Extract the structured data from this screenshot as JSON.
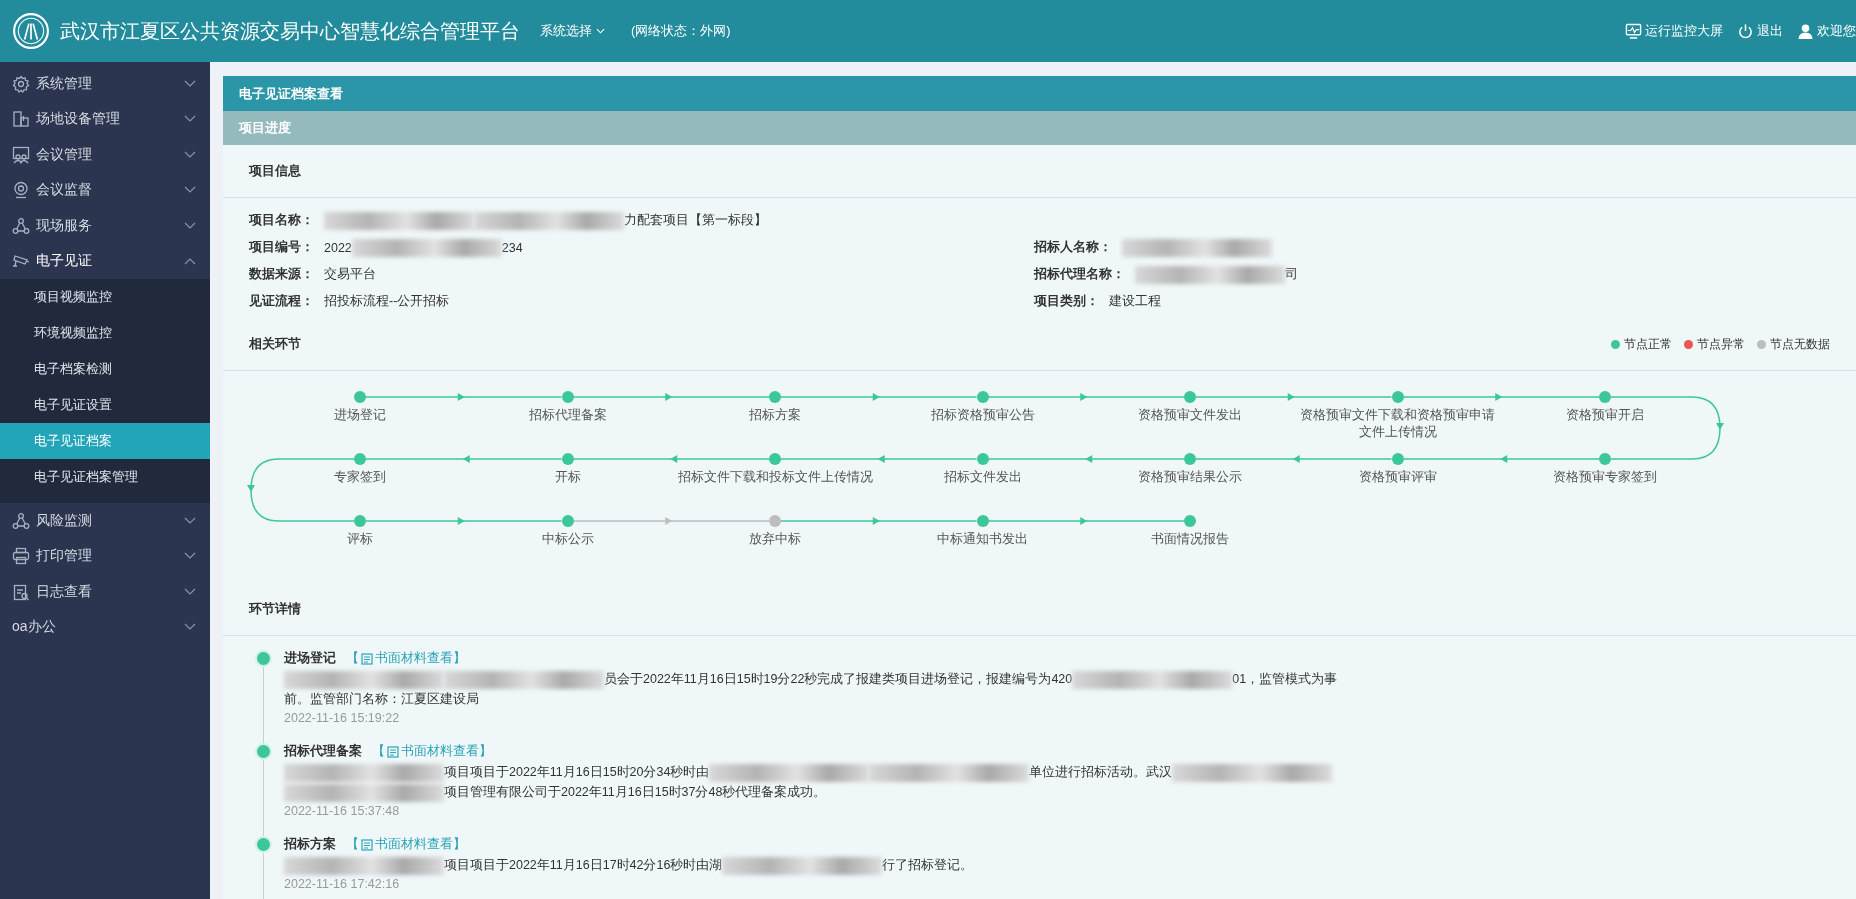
{
  "header": {
    "title": "武汉市江夏区公共资源交易中心智慧化综合管理平台",
    "system_select": "系统选择",
    "network_status": "(网络状态：外网)",
    "actions": [
      {
        "label": "运行监控大屏"
      },
      {
        "label": "退出"
      },
      {
        "label": "欢迎您"
      }
    ]
  },
  "sidebar": {
    "items": [
      {
        "label": "系统管理",
        "expanded": false
      },
      {
        "label": "场地设备管理",
        "expanded": false
      },
      {
        "label": "会议管理",
        "expanded": false
      },
      {
        "label": "会议监督",
        "expanded": false
      },
      {
        "label": "现场服务",
        "expanded": false
      },
      {
        "label": "电子见证",
        "expanded": true,
        "children": [
          {
            "label": "项目视频监控",
            "selected": false
          },
          {
            "label": "环境视频监控",
            "selected": false
          },
          {
            "label": "电子档案检测",
            "selected": false
          },
          {
            "label": "电子见证设置",
            "selected": false
          },
          {
            "label": "电子见证档案",
            "selected": true
          },
          {
            "label": "电子见证档案管理",
            "selected": false
          }
        ]
      },
      {
        "label": "风险监测",
        "expanded": false
      },
      {
        "label": "打印管理",
        "expanded": false
      },
      {
        "label": "日志查看",
        "expanded": false
      },
      {
        "label": "oa办公",
        "expanded": false
      }
    ]
  },
  "page_title": "电子见证档案查看",
  "sub_title": "项目进度",
  "project_info": {
    "title": "项目信息",
    "rows": [
      [
        {
          "label": "项目名称：",
          "parts": [
            {
              "kind": "redacted"
            },
            {
              "kind": "redacted"
            },
            {
              "kind": "text",
              "text": "力配套项目【第一标段】"
            }
          ]
        }
      ],
      [
        {
          "label": "项目编号：",
          "parts": [
            {
              "kind": "text",
              "text": "2022"
            },
            {
              "kind": "redacted"
            },
            {
              "kind": "text",
              "text": "234"
            }
          ]
        },
        {
          "label": "招标人名称：",
          "parts": [
            {
              "kind": "redacted"
            }
          ]
        }
      ],
      [
        {
          "label": "数据来源：",
          "parts": [
            {
              "kind": "text",
              "text": "交易平台"
            }
          ]
        },
        {
          "label": "招标代理名称：",
          "parts": [
            {
              "kind": "redacted"
            },
            {
              "kind": "text",
              "text": "司"
            }
          ]
        }
      ],
      [
        {
          "label": "见证流程：",
          "parts": [
            {
              "kind": "text",
              "text": "招投标流程--公开招标"
            }
          ]
        },
        {
          "label": "项目类别：",
          "parts": [
            {
              "kind": "text",
              "text": "建设工程"
            }
          ]
        }
      ]
    ]
  },
  "flow": {
    "title": "相关环节",
    "legend": [
      {
        "label": "节点正常",
        "color": "#3cc79a"
      },
      {
        "label": "节点异常",
        "color": "#e9574f"
      },
      {
        "label": "节点无数据",
        "color": "#bdbdbd"
      }
    ],
    "nodes": [
      {
        "label": "进场登记",
        "color": "#3cc79a"
      },
      {
        "label": "招标代理备案",
        "color": "#3cc79a"
      },
      {
        "label": "招标方案",
        "color": "#3cc79a"
      },
      {
        "label": "招标资格预审公告",
        "color": "#3cc79a"
      },
      {
        "label": "资格预审文件发出",
        "color": "#3cc79a"
      },
      {
        "label": "资格预审文件下载和资格预审申请文件上传情况",
        "color": "#3cc79a"
      },
      {
        "label": "资格预审开启",
        "color": "#3cc79a"
      },
      {
        "label": "专家签到",
        "color": "#3cc79a"
      },
      {
        "label": "开标",
        "color": "#3cc79a"
      },
      {
        "label": "招标文件下载和投标文件上传情况",
        "color": "#3cc79a"
      },
      {
        "label": "招标文件发出",
        "color": "#3cc79a"
      },
      {
        "label": "资格预审结果公示",
        "color": "#3cc79a"
      },
      {
        "label": "资格预审评审",
        "color": "#3cc79a"
      },
      {
        "label": "资格预审专家签到",
        "color": "#3cc79a"
      },
      {
        "label": "评标",
        "color": "#3cc79a"
      },
      {
        "label": "中标公示",
        "color": "#3cc79a"
      },
      {
        "label": "放弃中标",
        "color": "#bdbdbd"
      },
      {
        "label": "中标通知书发出",
        "color": "#3cc79a"
      },
      {
        "label": "书面情况报告",
        "color": "#3cc79a"
      }
    ]
  },
  "details": {
    "title": "环节详情",
    "entries": [
      {
        "title": "进场登记",
        "link": {
          "before": "【",
          "label": "书面材料查看",
          "after": "】"
        },
        "parts": [
          {
            "kind": "redacted"
          },
          {
            "kind": "redacted"
          },
          {
            "kind": "text",
            "text": "员会于2022年11月16日15时19分22秒完成了报建类项目进场登记，报建编号为420"
          },
          {
            "kind": "redacted"
          },
          {
            "kind": "text",
            "text": "01，监管模式为事前。监管部门名称：江夏区建设局"
          }
        ],
        "date": "2022-11-16 15:19:22"
      },
      {
        "title": "招标代理备案",
        "link": {
          "before": "【",
          "label": "书面材料查看",
          "after": "】"
        },
        "parts": [
          {
            "kind": "redacted"
          },
          {
            "kind": "text",
            "text": "项目项目于2022年11月16日15时20分34秒时由"
          },
          {
            "kind": "redacted"
          },
          {
            "kind": "redacted"
          },
          {
            "kind": "text",
            "text": "单位进行招标活动。武汉"
          },
          {
            "kind": "redacted"
          },
          {
            "kind": "redacted"
          },
          {
            "kind": "text",
            "text": "项目管理有限公司于2022年11月16日15时37分48秒代理备案成功。"
          }
        ],
        "date": "2022-11-16 15:37:48"
      },
      {
        "title": "招标方案",
        "link": {
          "before": "【",
          "label": "书面材料查看",
          "after": "】"
        },
        "parts": [
          {
            "kind": "redacted"
          },
          {
            "kind": "text",
            "text": "项目项目于2022年11月16日17时42分16秒时由湖"
          },
          {
            "kind": "redacted"
          },
          {
            "kind": "text",
            "text": "行了招标登记。"
          }
        ],
        "date": "2022-11-16 17:42:16"
      }
    ]
  }
}
